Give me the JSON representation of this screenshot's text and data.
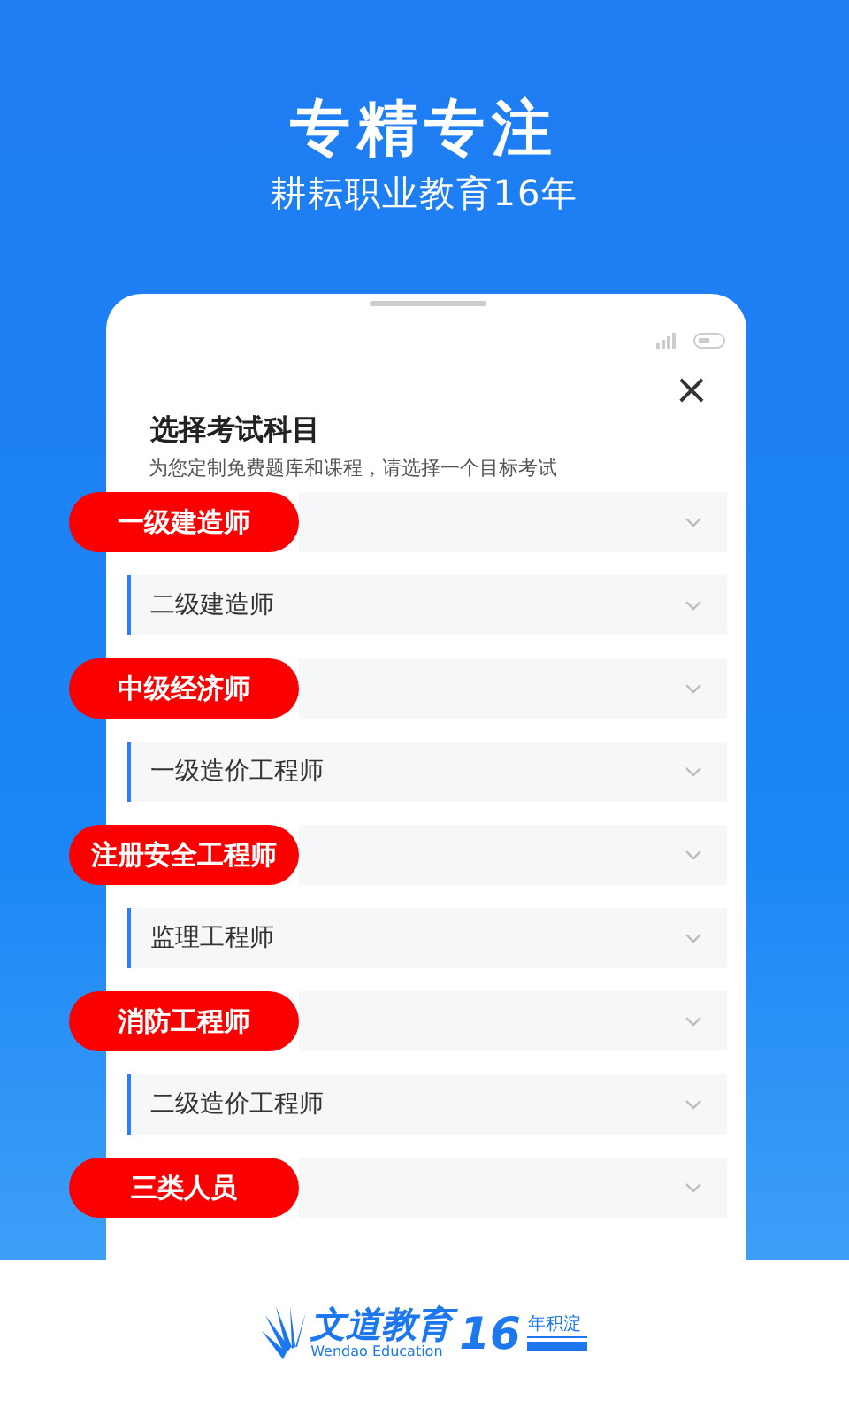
{
  "header": {
    "title": "专精专注",
    "subtitle": "耕耘职业教育16年"
  },
  "sheet": {
    "title": "选择考试科目",
    "subtitle": "为您定制免费题库和课程，请选择一个目标考试",
    "close": "×"
  },
  "rows": [
    {
      "kind": "callout",
      "label": "一级建造师"
    },
    {
      "kind": "plain",
      "label": "二级建造师"
    },
    {
      "kind": "callout",
      "label": "中级经济师"
    },
    {
      "kind": "plain",
      "label": "一级造价工程师"
    },
    {
      "kind": "callout",
      "label": "注册安全工程师"
    },
    {
      "kind": "plain",
      "label": "监理工程师"
    },
    {
      "kind": "callout",
      "label": "消防工程师"
    },
    {
      "kind": "plain",
      "label": "二级造价工程师"
    },
    {
      "kind": "callout",
      "label": "三类人员"
    }
  ],
  "logo": {
    "name": "文道教育",
    "english": "Wendao Education",
    "years": "16",
    "tag": "年积淀"
  }
}
